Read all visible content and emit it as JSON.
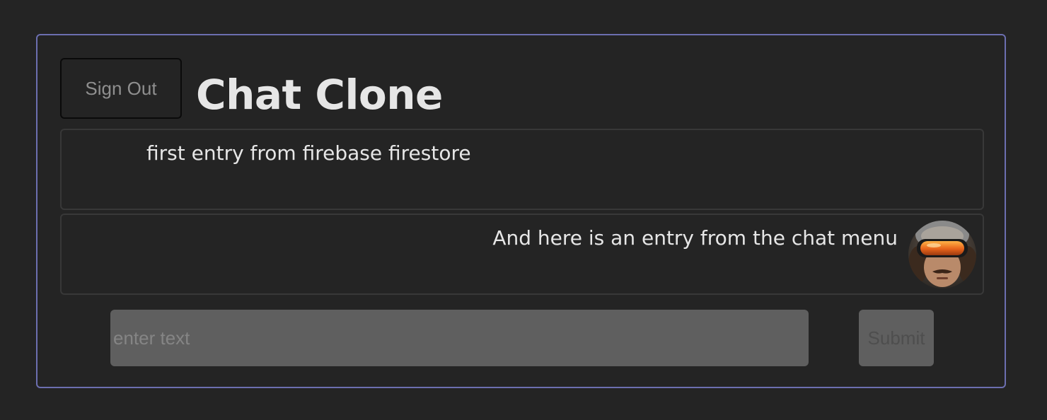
{
  "header": {
    "sign_out_label": "Sign Out",
    "title": "Chat Clone"
  },
  "messages": [
    {
      "text": "first entry from firebase firestore",
      "alignment": "left",
      "has_avatar": false
    },
    {
      "text": "And here is an entry from the chat menu",
      "alignment": "right",
      "has_avatar": true,
      "avatar_icon": "user-avatar-goggles"
    }
  ],
  "composer": {
    "value": "",
    "placeholder": "enter text",
    "submit_label": "Submit"
  },
  "colors": {
    "background": "#242424",
    "frame_border": "#6c6fb0",
    "card_border": "#383838",
    "input_bg": "#5f5f5f",
    "text": "#e6e6e6"
  }
}
